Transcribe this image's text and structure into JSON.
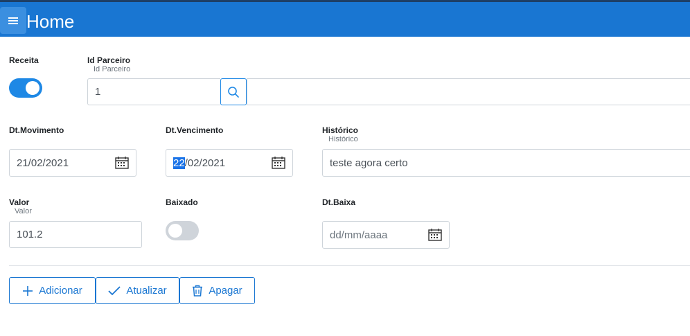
{
  "header": {
    "title": "Home",
    "menu_icon": "hamburger-menu-icon",
    "background": "#1976d2"
  },
  "form": {
    "receita": {
      "label": "Receita",
      "checked": true
    },
    "id_parceiro": {
      "label": "Id Parceiro",
      "sublabel": "Id Parceiro",
      "value": "1",
      "search_icon": "search-icon"
    },
    "dt_movimento": {
      "label": "Dt.Movimento",
      "value": "21/02/2021"
    },
    "dt_vencimento": {
      "label": "Dt.Vencimento",
      "value_selected": "22",
      "value_rest": "/02/2021"
    },
    "historico": {
      "label": "Histórico",
      "sublabel": "Histórico",
      "value": "teste agora certo"
    },
    "valor": {
      "label": "Valor",
      "sublabel": "Valor",
      "value": "101.2"
    },
    "baixado": {
      "label": "Baixado",
      "checked": false
    },
    "dt_baixa": {
      "label": "Dt.Baixa",
      "placeholder": "dd/mm/aaaa"
    }
  },
  "actions": {
    "adicionar": {
      "label": "Adicionar",
      "icon": "plus-icon"
    },
    "atualizar": {
      "label": "Atualizar",
      "icon": "check-icon"
    },
    "apagar": {
      "label": "Apagar",
      "icon": "trash-icon"
    }
  },
  "colors": {
    "accent": "#1976d2",
    "toggle_on": "#1e88e5",
    "toggle_off": "#cfd4da"
  }
}
